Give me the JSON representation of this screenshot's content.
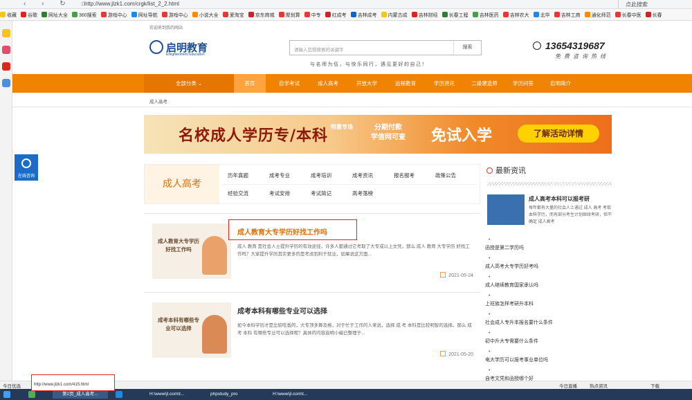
{
  "browser": {
    "url": "http://www.jlzk1.com/crgk/list_2_2.html",
    "search_placeholder": "点此搜索",
    "bookmarks": [
      "收藏",
      "谷歌",
      "网址大全",
      "360搜索",
      "游戏中心",
      "网址导航",
      "游戏中心",
      "小说大全",
      "爱淘宝",
      "京东商城",
      "聚划算",
      "中专",
      "红成考",
      "吉林成考",
      "内蒙古成",
      "吉林财经",
      "长春工程",
      "吉林医药",
      "吉林农大",
      "北华",
      "吉林工商",
      "通化师范",
      "长春中医",
      "长春"
    ]
  },
  "site": {
    "welcome": "欢迎来到我的网站",
    "logo_cn": "启明教育",
    "logo_en": "Enlightenment Education",
    "search_placeholder": "请输入您想搜索的关键字",
    "search_button": "搜索",
    "slogan": "与名师为伍，与快乐同行，遇见更好的自己！",
    "phone": "13654319687",
    "hotline": "免费咨询热线"
  },
  "menu": [
    "全部分类 ⌄",
    "首页",
    "自学考试",
    "成人高考",
    "开放大学",
    "远程教育",
    "学历资讯",
    "二级建造师",
    "学历问答",
    "启明简介"
  ],
  "breadcrumb": "成人高考",
  "banner": {
    "main": "名校成人学历专/本科",
    "tag": "特惠专场",
    "mid1": "分期付款",
    "mid2": "学信网可查",
    "free": "免试入学",
    "cta": "了解活动详情"
  },
  "online_consult": "在线咨询",
  "category": {
    "title": "成人高考",
    "row1": [
      "历年真题",
      "成考专业",
      "成考培训",
      "成考资讯",
      "报名报考",
      "政策公告"
    ],
    "row2": [
      "经验交流",
      "考试安排",
      "考试简记",
      "高考落榜"
    ]
  },
  "articles": [
    {
      "img_caption": "成人教育大专学历好找工作吗",
      "title": "成人教育大专学历好找工作吗",
      "desc": "成人 教育 是社会人士提升学历的有效途径，许多人都通过它考取了大专或以上文凭，那么 成人 教育 大专学历 好找工作吗？大家提升学历其实更多的是考虑到利于就业，如果说这方面...",
      "date": "2021-05-24"
    },
    {
      "img_caption": "成考本科有哪些专业可以选择",
      "title": "成考本科有哪些专业可以选择",
      "desc": "如今本科学历才是比较吃香的，大专顶多算及格，对于忙于工作的人来说，选择 成 考 本科是比较明智的选择。那么 成考 本科 有哪些专业可以选择呢？具体的内容启明小编已整理于...",
      "date": "2021-05-20"
    }
  ],
  "news": {
    "heading": "最新资讯",
    "featured_title": "成人高考本科可以报考研",
    "featured_desc": "每年都有大量的社会人士通过 成人 高考 考取本科学历，而有部分考生计划继续考研，但不确定 成人高考",
    "items": [
      "函授是第二学历吗",
      "成人高考大专学历好考吗",
      "成人继续教育国家承认吗",
      "上班族怎样考研升本科",
      "社会成人专升本报名要什么条件",
      "初中升大专需要什么条件",
      "电大学历可以报考事业单位吗",
      "自考文凭和函授哪个好"
    ]
  },
  "status_bar": {
    "left": "今日优选",
    "hover_url": "http://www.jlzk1.com/415.html",
    "live": "今日直播",
    "hot": "热点资讯",
    "download": "下载"
  },
  "taskbar": [
    "第2页_成人高考...",
    "",
    "H:\\www\\jl.com\\t...",
    "phpstudy_pro",
    "H:\\www\\jl.com\\t..."
  ],
  "colors": {
    "brand_orange": "#f08300",
    "highlight_red": "#e0251d",
    "brand_blue": "#1f4f8f"
  }
}
